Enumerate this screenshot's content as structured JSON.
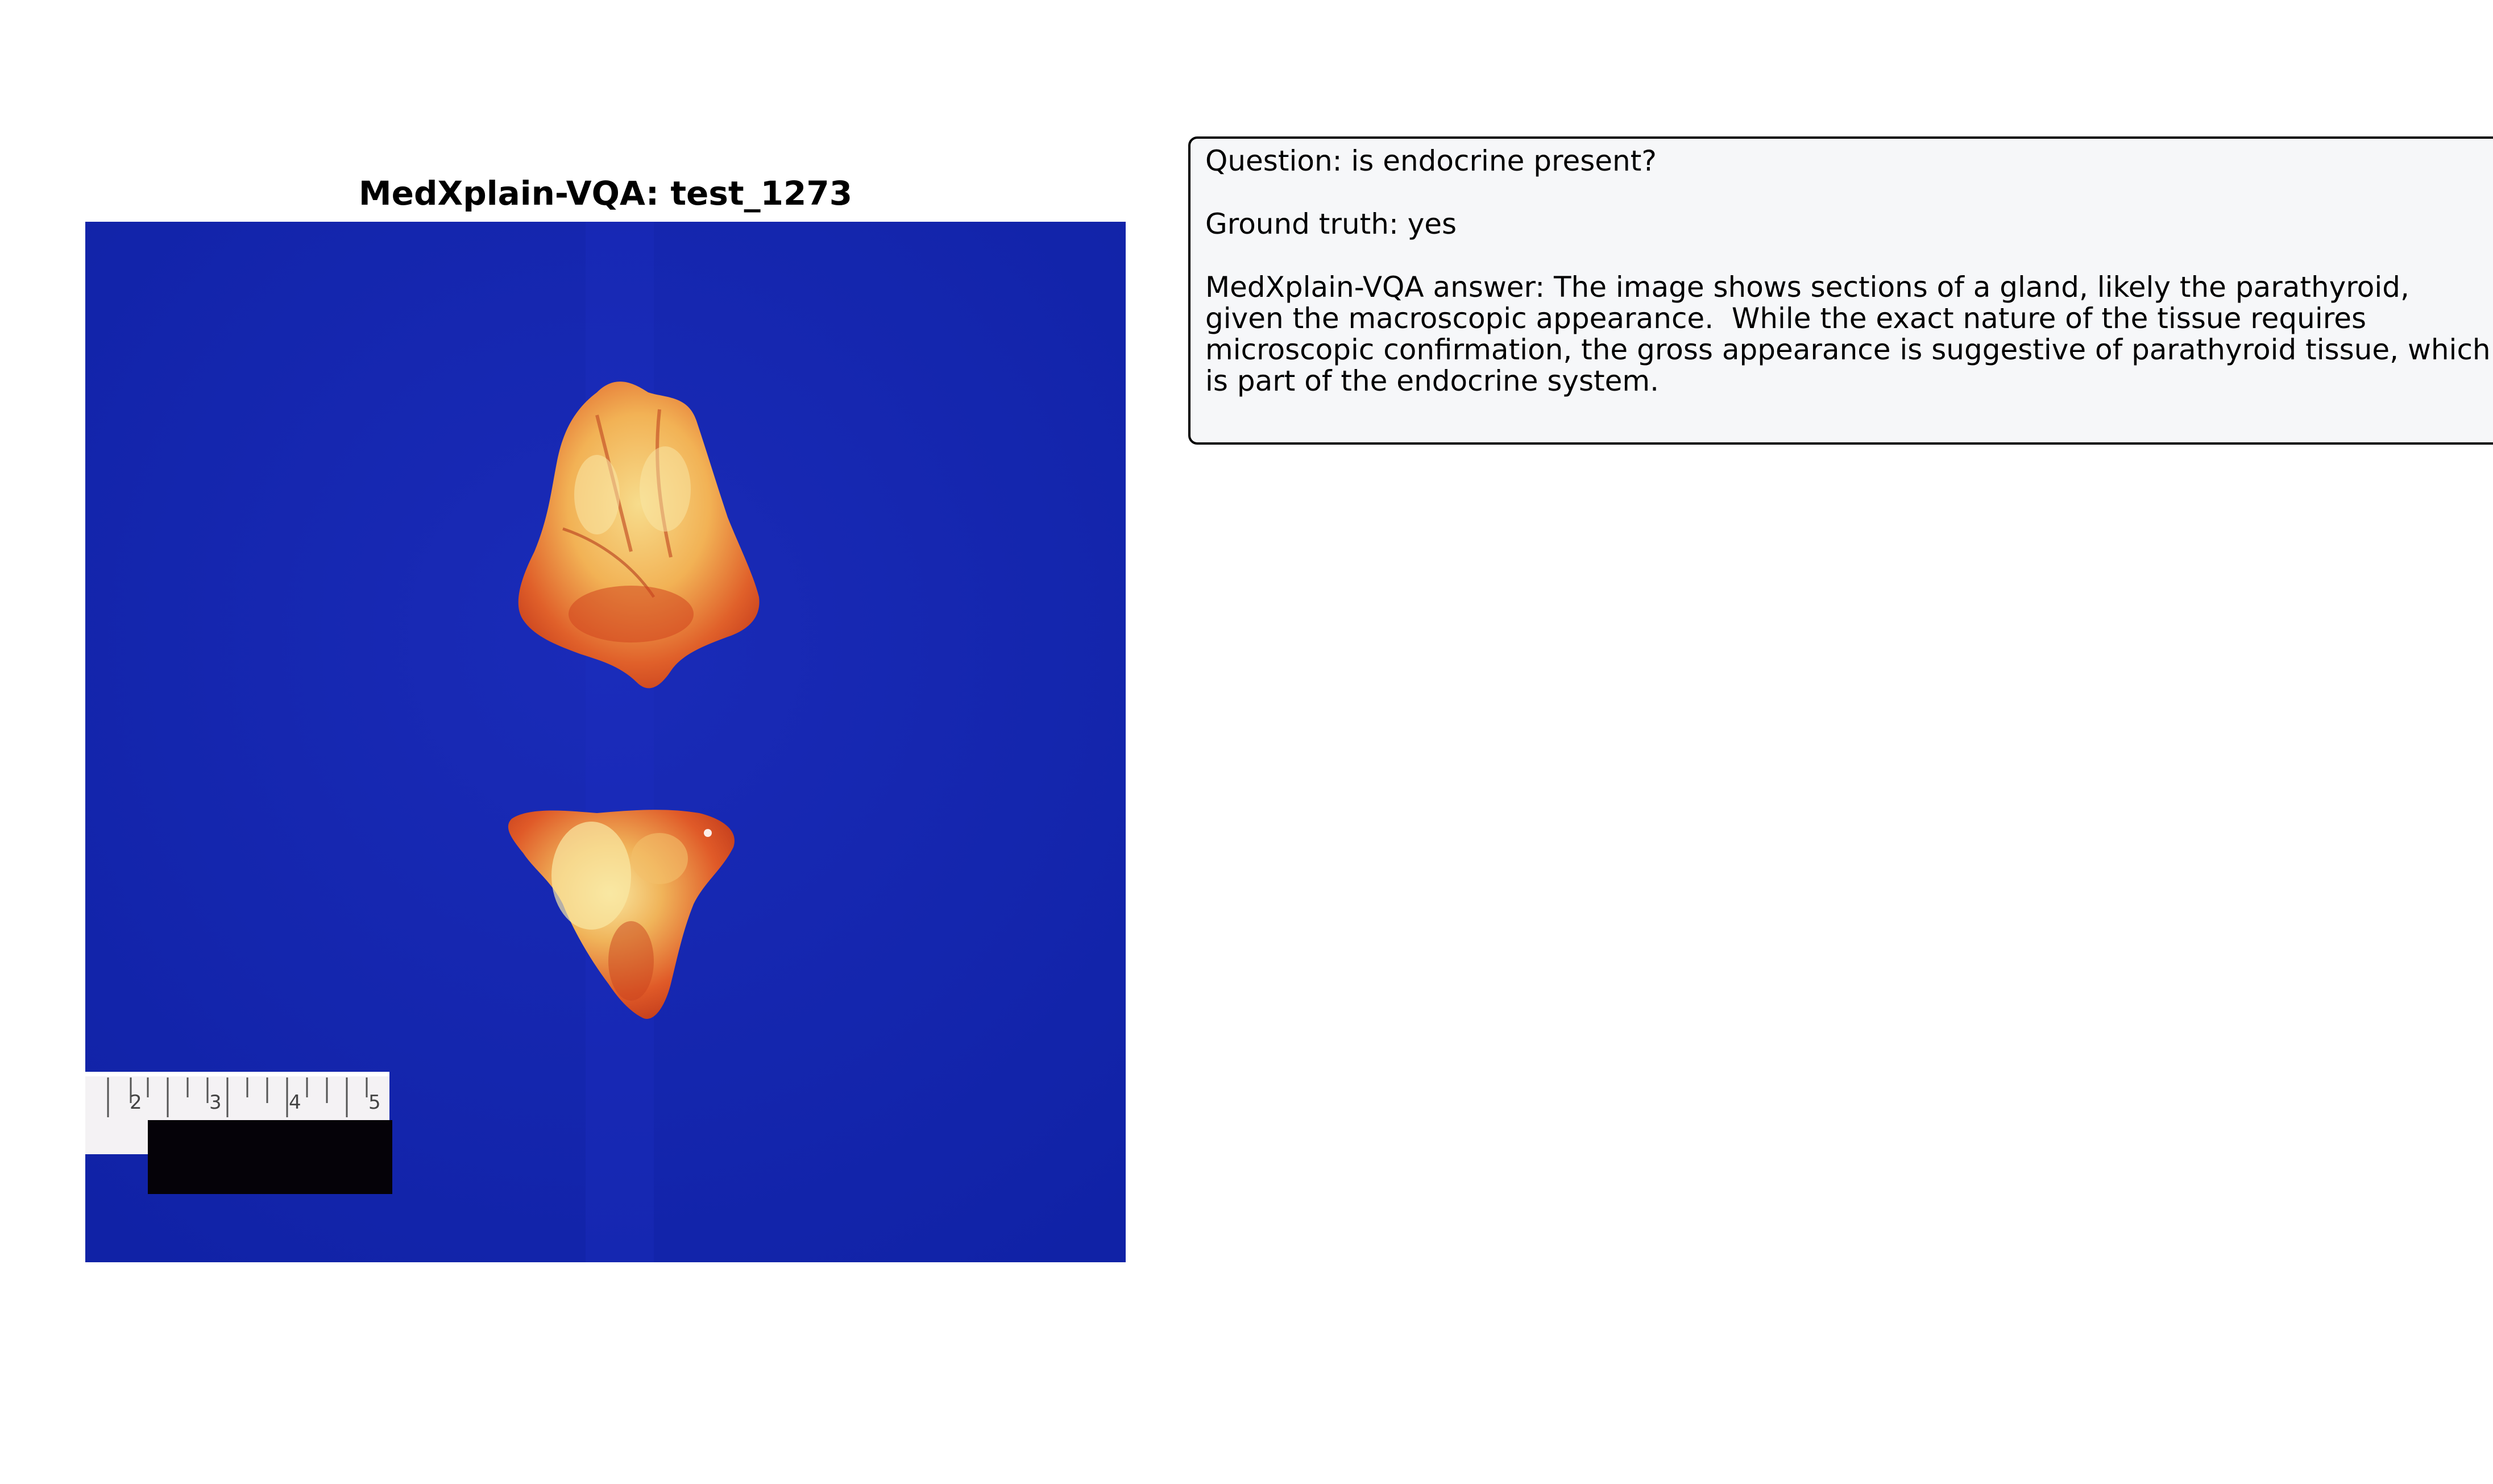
{
  "figure": {
    "title": "MedXplain-VQA: test_1273"
  },
  "image": {
    "subject": "gross pathology photo: two tissue sections on blue background with ruler",
    "background_color": "#1426ad",
    "tissue_color": "#e2562a",
    "ruler_marks": [
      "2",
      "3",
      "4",
      "5"
    ]
  },
  "qa": {
    "question_line": "Question: is endocrine present?",
    "ground_truth_line": "Ground truth: yes",
    "answer_lines": [
      "MedXplain-VQA answer: The image shows sections of a gland, likely the parathyroid,",
      "given the macroscopic appearance.  While the exact nature of the tissue requires",
      "microscopic confirmation, the gross appearance is suggestive of parathyroid tissue, which",
      "is part of the endocrine system."
    ]
  }
}
